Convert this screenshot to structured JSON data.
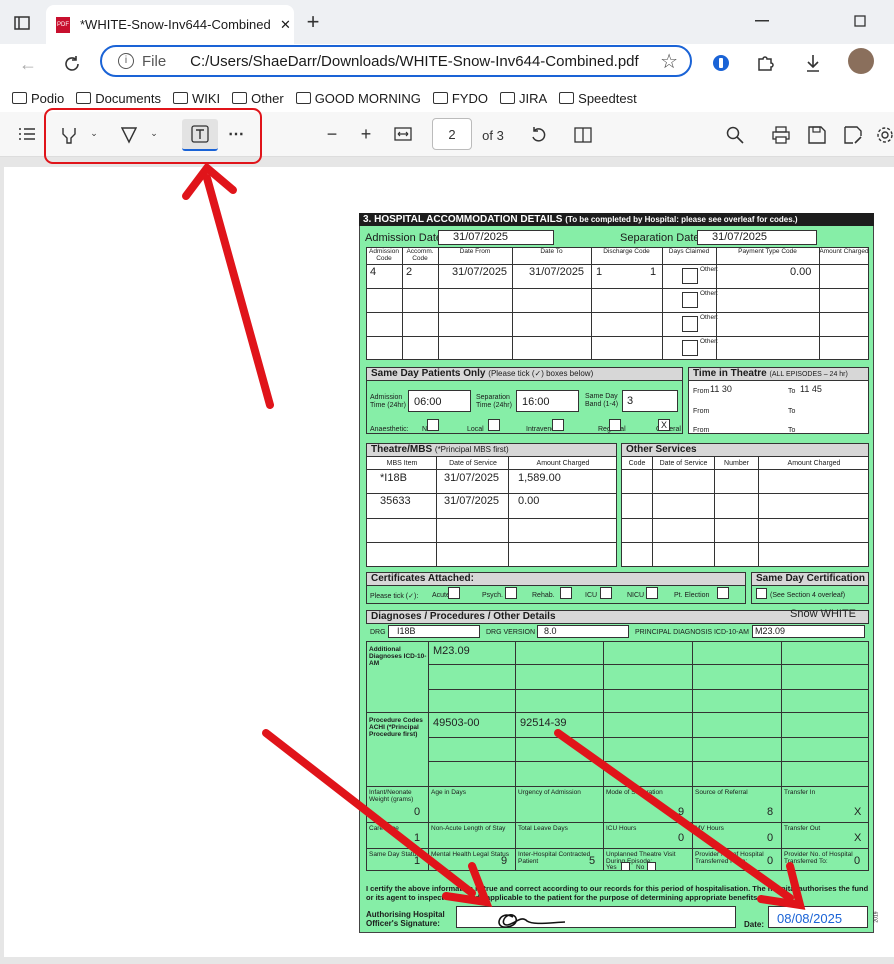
{
  "tab": {
    "title": "*WHITE-Snow-Inv644-Combined.pdf",
    "close": "✕",
    "new": "+"
  },
  "address": {
    "scheme": "File",
    "url": "C:/Users/ShaeDarr/Downloads/WHITE-Snow-Inv644-Combined.pdf"
  },
  "bookmarks": [
    "Podio",
    "Documents",
    "WIKI",
    "Other",
    "GOOD MORNING",
    "FYDO",
    "JIRA",
    "Speedtest"
  ],
  "pdf": {
    "page": "2",
    "of": "of 3"
  },
  "form": {
    "title": "3. HOSPITAL ACCOMMODATION DETAILS",
    "title_note": "(To be completed by Hospital: please see overleaf for codes.)",
    "admission_label": "Admission Date:",
    "admission_value": "31/07/2025",
    "separation_label": "Separation Date:",
    "separation_value": "31/07/2025",
    "cols": [
      "Admission Code",
      "Accomm. Code",
      "Date From",
      "Date To",
      "Discharge Code",
      "Days Claimed",
      "Payment Type Code",
      "Amount Charged"
    ],
    "row": [
      "4",
      "2",
      "31/07/2025",
      "31/07/2025",
      "1",
      "1",
      "0.00"
    ],
    "other": "Other:",
    "sameday_title": "Same Day Patients Only",
    "sameday_note": "(Please tick (✓) boxes below)",
    "adm_time_label": "Admission Time (24hr)",
    "adm_time": "06:00",
    "sep_time_label": "Separation Time (24hr)",
    "sep_time": "16:00",
    "band_label": "Same Day Band (1-4)",
    "band": "3",
    "anaesthetic": "Anaesthetic:",
    "an_opts": [
      "None",
      "Local",
      "Intravenous",
      "Regional",
      "General"
    ],
    "general_mark": "X",
    "theatre_title": "Time in Theatre",
    "theatre_note": "(ALL EPISODES – 24 hr)",
    "from": "From",
    "to": "To",
    "from_val": "11 30",
    "to_val": "11 45",
    "mbs_title": "Theatre/MBS",
    "mbs_note": "(*Principal MBS first)",
    "mbs_cols": [
      "MBS Item",
      "Date of Service",
      "Amount Charged"
    ],
    "mbs_rows": [
      [
        "*I18B",
        "31/07/2025",
        "1,589.00"
      ],
      [
        "35633",
        "31/07/2025",
        "0.00"
      ]
    ],
    "other_services": "Other Services",
    "os_cols": [
      "Code",
      "Date of Service",
      "Number",
      "Amount Charged"
    ],
    "cert_title": "Certificates Attached:",
    "cert_opts": [
      "Please tick (✓):",
      "Acute",
      "Psych.",
      "Rehab.",
      "ICU",
      "NICU",
      "Pt. Election"
    ],
    "sdc_title": "Same Day Certification",
    "sdc_note": "(See Section 4 overleaf)",
    "diag_title": "Diagnoses / Procedures / Other Details",
    "patient": "Snow WHITE",
    "drg_label": "DRG",
    "drg": "I18B",
    "drg_ver_label": "DRG VERSION",
    "drg_ver": "8.0",
    "pd_label": "PRINCIPAL DIAGNOSIS ICD-10-AM",
    "pd": "M23.09",
    "add_diag_label": "Additional Diagnoses ICD-10-AM",
    "add_diag": "M23.09",
    "proc_label": "Procedure Codes ACHI (*Principal Procedure first)",
    "proc1": "49503-00",
    "proc2": "92514-39",
    "r1": [
      [
        "Infant/Neonate Weight (grams)",
        "0"
      ],
      [
        "Age in Days",
        ""
      ],
      [
        "Urgency of Admission",
        ""
      ],
      [
        "Mode of Separation",
        "9"
      ],
      [
        "Source of Referral",
        "8"
      ],
      [
        "Transfer In",
        "X"
      ]
    ],
    "r2": [
      [
        "Care Type",
        "1"
      ],
      [
        "Non-Acute Length of Stay",
        ""
      ],
      [
        "Total Leave Days",
        ""
      ],
      [
        "ICU Hours",
        "0"
      ],
      [
        "MV Hours",
        "0"
      ],
      [
        "Transfer Out",
        "X"
      ]
    ],
    "r3": [
      [
        "Same Day Status",
        "1"
      ],
      [
        "Mental Health Legal Status",
        "9"
      ],
      [
        "Inter-Hospital Contracted Patient",
        "5"
      ],
      [
        "Unplanned Theatre Visit During Episode:",
        ""
      ],
      [
        "Provider No. of Hospital Transferred From:",
        "0"
      ],
      [
        "Provider No. of Hospital Transferred To:",
        "0"
      ]
    ],
    "yes": "Yes",
    "no": "No",
    "certify": "I certify the above information is true and correct according to our records for this period of hospitalisation. The hospital authorises the fund or its agent to inspect all records applicable to the patient for the purpose of determining appropriate benefits.",
    "auth_label": "Authorising Hospital Officer's Signature:",
    "date_label": "Date:",
    "date": "08/08/2025",
    "year": "2019"
  },
  "colors": {
    "form": "#86eea7",
    "annotation": "#e0141a",
    "accent": "#1a63d6"
  }
}
